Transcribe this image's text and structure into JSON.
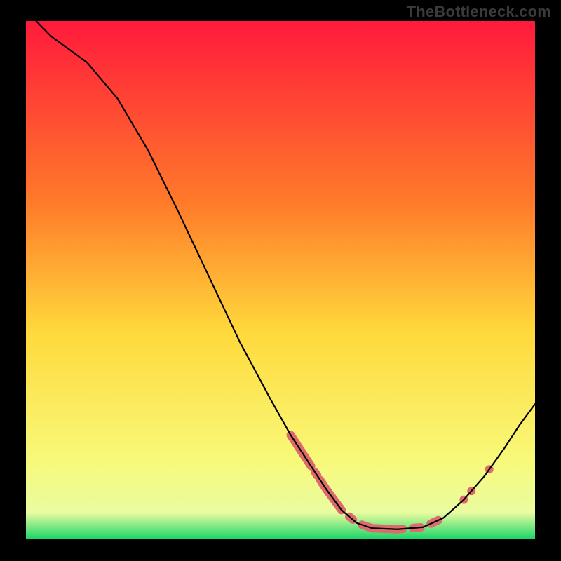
{
  "watermark": "TheBottleneck.com",
  "chart_data": {
    "type": "line",
    "title": "",
    "xlabel": "",
    "ylabel": "",
    "xlim": [
      0,
      100
    ],
    "ylim": [
      0,
      100
    ],
    "grid": false,
    "legend": false,
    "gradient_stops": [
      {
        "offset": 0,
        "color": "#ff1a3c"
      },
      {
        "offset": 35,
        "color": "#ff7a2a"
      },
      {
        "offset": 60,
        "color": "#ffd93b"
      },
      {
        "offset": 85,
        "color": "#f8f97a"
      },
      {
        "offset": 95,
        "color": "#e9fca0"
      },
      {
        "offset": 100,
        "color": "#1fd66a"
      }
    ],
    "series": [
      {
        "name": "bottleneck-curve",
        "color": "#000000",
        "points": [
          {
            "x": 2.0,
            "y": 100.0
          },
          {
            "x": 5.0,
            "y": 97.0
          },
          {
            "x": 12.0,
            "y": 92.0
          },
          {
            "x": 18.0,
            "y": 85.0
          },
          {
            "x": 24.0,
            "y": 75.0
          },
          {
            "x": 30.0,
            "y": 63.0
          },
          {
            "x": 36.0,
            "y": 50.5
          },
          {
            "x": 42.0,
            "y": 38.0
          },
          {
            "x": 48.0,
            "y": 27.0
          },
          {
            "x": 52.0,
            "y": 20.0
          },
          {
            "x": 56.0,
            "y": 14.0
          },
          {
            "x": 59.0,
            "y": 9.5
          },
          {
            "x": 62.0,
            "y": 5.5
          },
          {
            "x": 65.0,
            "y": 3.0
          },
          {
            "x": 68.0,
            "y": 2.0
          },
          {
            "x": 73.0,
            "y": 1.8
          },
          {
            "x": 78.0,
            "y": 2.2
          },
          {
            "x": 82.0,
            "y": 4.0
          },
          {
            "x": 86.0,
            "y": 7.5
          },
          {
            "x": 90.0,
            "y": 12.0
          },
          {
            "x": 94.0,
            "y": 17.5
          },
          {
            "x": 97.0,
            "y": 22.0
          },
          {
            "x": 100.0,
            "y": 26.0
          }
        ]
      }
    ],
    "dot_segments": [
      {
        "x1": 52.0,
        "x2": 56.0
      },
      {
        "x1": 56.8,
        "x2": 57.2
      },
      {
        "x1": 57.8,
        "x2": 62.0
      },
      {
        "x1": 63.5,
        "x2": 64.2
      },
      {
        "x1": 66.0,
        "x2": 74.0
      },
      {
        "x1": 76.0,
        "x2": 77.5
      },
      {
        "x1": 79.5,
        "x2": 81.0
      }
    ],
    "dot_points": [
      {
        "x": 52.8
      },
      {
        "x": 54.0
      },
      {
        "x": 86.0
      },
      {
        "x": 87.5
      },
      {
        "x": 91.0
      }
    ],
    "dot_style": {
      "color": "#de6b6b",
      "radius": 6,
      "segment_width": 12
    }
  }
}
